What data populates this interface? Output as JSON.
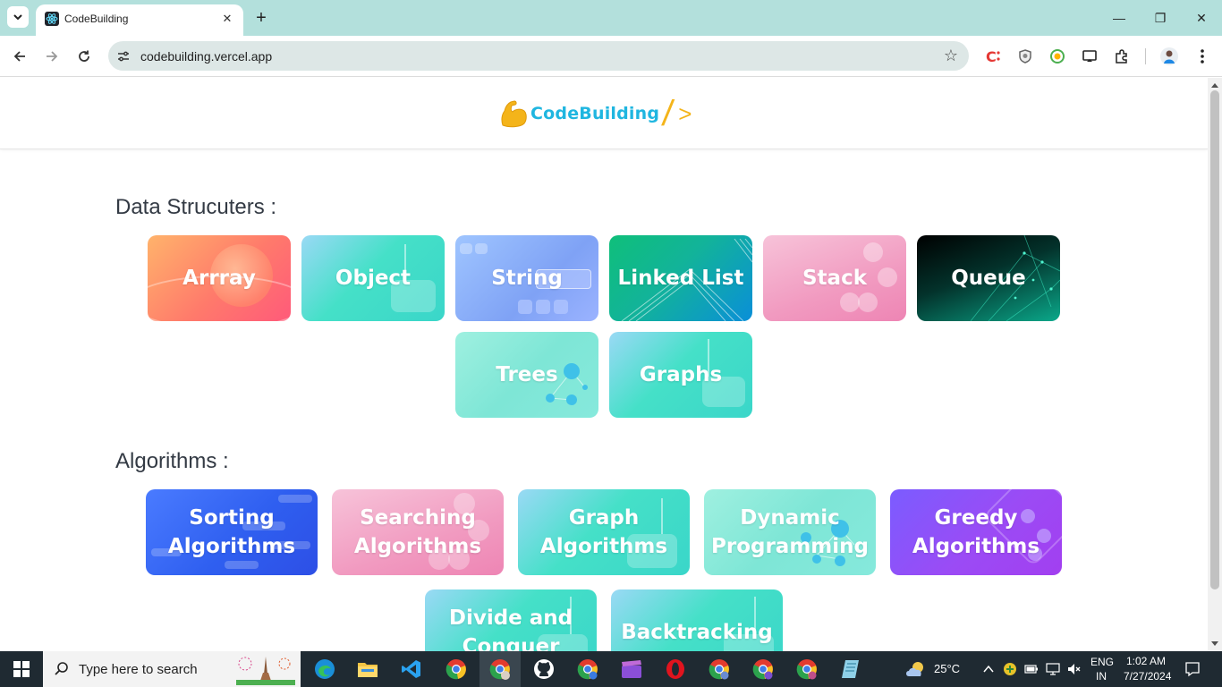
{
  "browser": {
    "tab_title": "CodeBuilding",
    "url": "codebuilding.vercel.app",
    "tab_close": "✕",
    "new_tab": "+",
    "minimize": "—",
    "restore": "❐",
    "close": "✕"
  },
  "site": {
    "logo_text": "CodeBuilding",
    "logo_slash": "/",
    "logo_gt": ">"
  },
  "sections": {
    "data_structures": {
      "title": "Data Strucuters :",
      "cards": [
        {
          "label": "Arrray"
        },
        {
          "label": "Object"
        },
        {
          "label": "String"
        },
        {
          "label": "Linked List"
        },
        {
          "label": "Stack"
        },
        {
          "label": "Queue"
        },
        {
          "label": "Trees"
        },
        {
          "label": "Graphs"
        }
      ]
    },
    "algorithms": {
      "title": "Algorithms :",
      "cards": [
        {
          "line1": "Sorting",
          "line2": "Algorithms"
        },
        {
          "line1": "Searching",
          "line2": "Algorithms"
        },
        {
          "line1": "Graph",
          "line2": "Algorithms"
        },
        {
          "line1": "Dynamic",
          "line2": "Programming"
        },
        {
          "line1": "Greedy",
          "line2": "Algorithms"
        },
        {
          "line1": "Divide and",
          "line2": "Conquer"
        },
        {
          "line1": "Backtracking",
          "line2": ""
        }
      ]
    }
  },
  "taskbar": {
    "search_placeholder": "Type here to search",
    "weather": "25°C",
    "language": "ENG",
    "region": "IN",
    "time": "1:02 AM",
    "date": "7/27/2024"
  },
  "colors": {
    "tabbar": "#b3e0dc",
    "taskbar": "#1f2a32",
    "logo_blue": "#1fb6e0",
    "logo_yellow": "#f4b41a"
  }
}
